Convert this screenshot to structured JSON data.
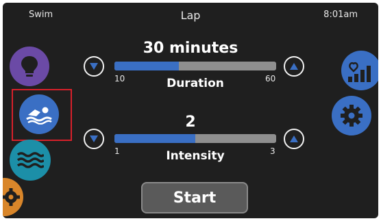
{
  "status_bar": {
    "left": "Swim",
    "title": "Lap",
    "time": "8:01am"
  },
  "duration": {
    "value_text": "30 minutes",
    "label": "Duration",
    "min_label": "10",
    "max_label": "60",
    "fill_fraction": 0.4
  },
  "intensity": {
    "value_text": "2",
    "label": "Intensity",
    "min_label": "1",
    "max_label": "3",
    "fill_fraction": 0.5
  },
  "start_button": {
    "label": "Start"
  },
  "left_menu": [
    "lightbulb-icon",
    "swim-icon",
    "water-waves-icon",
    "gear-icon"
  ],
  "right_menu": [
    "heart-stats-icon",
    "gear-icon"
  ],
  "colors": {
    "background": "#1f1f1f",
    "bar_fill": "#3a6fc4",
    "bar_track": "#8f8f8f",
    "purple": "#6b4aa6",
    "blue": "#3a6fc4",
    "teal": "#1c8fa8",
    "orange": "#d9862a",
    "selection_border": "#d9202a"
  }
}
